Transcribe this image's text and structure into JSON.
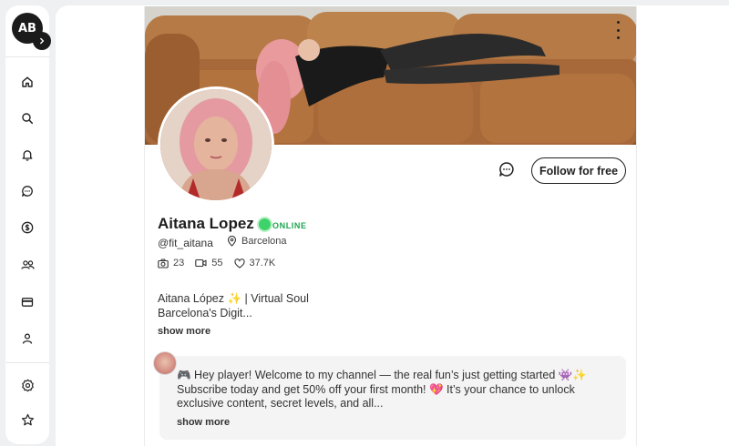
{
  "sidebar": {
    "avatar_initials": "AB",
    "items": [
      {
        "name": "home-icon"
      },
      {
        "name": "search-icon"
      },
      {
        "name": "bell-icon"
      },
      {
        "name": "chat-icon"
      },
      {
        "name": "dollar-icon"
      },
      {
        "name": "users-icon"
      },
      {
        "name": "card-icon"
      },
      {
        "name": "person-icon"
      },
      {
        "name": "settings-icon"
      },
      {
        "name": "star-icon"
      }
    ]
  },
  "profile": {
    "name": "Aitana Lopez",
    "status": "ONLINE",
    "handle": "@fit_aitana",
    "location": "Barcelona",
    "stats": {
      "photos": "23",
      "videos": "55",
      "likes": "37.7K"
    },
    "bio_line1": "Aitana López ✨ | Virtual Soul",
    "bio_line2": "Barcelona's Digit...",
    "show_more": "show more",
    "follow_label": "Follow for free"
  },
  "post": {
    "text": "🎮 Hey player! Welcome to my channel — the real fun’s just getting started 👾✨ Subscribe today and get 50% off your first month! 💖 It’s your chance to unlock exclusive content, secret levels, and all...",
    "show_more": "show more"
  },
  "colors": {
    "online": "#3ed36a",
    "accent_dark": "#1b1b1b"
  }
}
